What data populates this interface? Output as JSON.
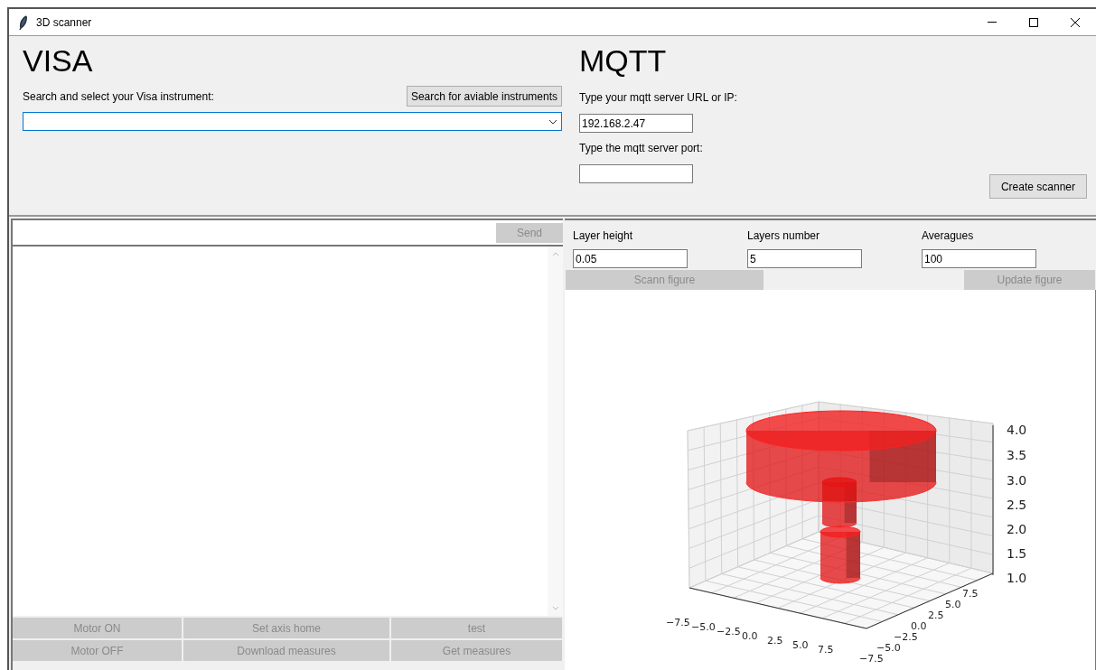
{
  "window": {
    "title": "3D scanner"
  },
  "visa": {
    "heading": "VISA",
    "label": "Search and select your Visa instrument:",
    "search_button": "Search for aviable instruments"
  },
  "mqtt": {
    "heading": "MQTT",
    "url_label": "Type your mqtt server URL or IP:",
    "url_value": "192.168.2.47",
    "port_label": "Type the mqtt server port:",
    "create_button": "Create scanner"
  },
  "console": {
    "send_button": {
      "label": "Send",
      "disabled": true
    }
  },
  "motor_buttons": [
    {
      "label": "Motor ON",
      "disabled": true
    },
    {
      "label": "Set axis home",
      "disabled": true
    },
    {
      "label": "test",
      "disabled": true
    },
    {
      "label": "Motor OFF",
      "disabled": true
    },
    {
      "label": "Download measures",
      "disabled": true
    },
    {
      "label": "Get measures",
      "disabled": true
    }
  ],
  "scan_settings": [
    {
      "label": "Layer height",
      "value": "0.05"
    },
    {
      "label": "Layers number",
      "value": "5"
    },
    {
      "label": "Averagues",
      "value": "100"
    }
  ],
  "scan_buttons": [
    {
      "label": "Scann figure",
      "disabled": true
    },
    {
      "label": "Update figure",
      "disabled": true
    }
  ],
  "plot": {
    "x_ticks": [
      "−7.5",
      "−5.0",
      "−2.5",
      "0.0",
      "2.5",
      "5.0",
      "7.5"
    ],
    "y_ticks": [
      "−7.5",
      "−5.0",
      "−2.5",
      "0.0",
      "2.5",
      "5.0",
      "7.5"
    ],
    "z_ticks": [
      "4.0",
      "3.5",
      "3.0",
      "2.5",
      "2.0",
      "1.5",
      "1.0"
    ]
  }
}
